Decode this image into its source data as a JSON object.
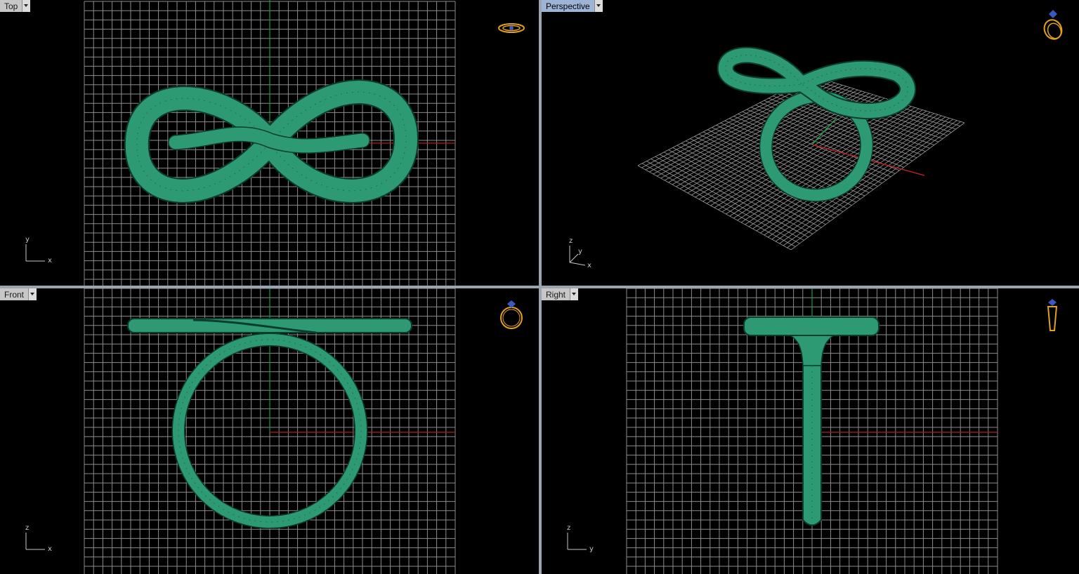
{
  "viewports": {
    "top": {
      "name": "Top",
      "axis_labels": [
        "y",
        "x"
      ]
    },
    "perspective": {
      "name": "Perspective",
      "axis_labels": [
        "z",
        "y",
        "x"
      ]
    },
    "front": {
      "name": "Front",
      "axis_labels": [
        "z",
        "x"
      ]
    },
    "right": {
      "name": "Right",
      "axis_labels": [
        "z",
        "y"
      ]
    }
  },
  "colors": {
    "model": "#2e9a74",
    "model_edge": "#0b3d2c",
    "grid": "#8c8c8c",
    "x_axis": "#b02020",
    "y_axis": "#1f9a44",
    "active_tab": "#9db4d6",
    "tab": "#c7c7c7",
    "view_cube_icon": "#e0a020"
  },
  "icons": {
    "view_cube": "ring-icon",
    "tab_menu": "chevron-down-icon"
  }
}
